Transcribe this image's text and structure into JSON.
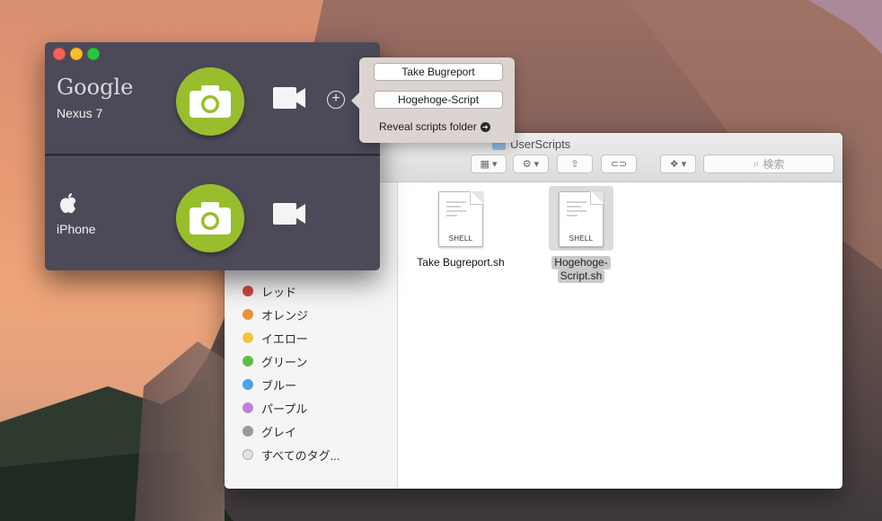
{
  "app": {
    "devices": [
      {
        "brand": "Google",
        "model": "Nexus 7"
      },
      {
        "brand": "apple-logo",
        "model": "iPhone"
      }
    ],
    "add_label": "+"
  },
  "popover": {
    "scripts": [
      "Take Bugreport",
      "Hogehoge-Script"
    ],
    "reveal_label": "Reveal scripts folder"
  },
  "finder": {
    "title": "UserScripts",
    "search_placeholder": "検索",
    "tags": [
      {
        "label": "レッド",
        "color": "#d24640"
      },
      {
        "label": "オレンジ",
        "color": "#e9923e"
      },
      {
        "label": "イエロー",
        "color": "#f1c63a"
      },
      {
        "label": "グリーン",
        "color": "#5dbf45"
      },
      {
        "label": "ブルー",
        "color": "#4aa3e3"
      },
      {
        "label": "パープル",
        "color": "#c27fd7"
      },
      {
        "label": "グレイ",
        "color": "#9a9a9a"
      },
      {
        "label": "すべてのタグ...",
        "color": "#e2e2e2"
      }
    ],
    "files": [
      {
        "name": "Take Bugreport.sh",
        "type": "SHELL"
      },
      {
        "name_line1": "Hogehoge-",
        "name_line2": "Script.sh",
        "type": "SHELL"
      }
    ]
  },
  "colors": {
    "app_bg": "#4c4a58",
    "camera_green": "#98be2e",
    "popover_bg": "#dcd4d1"
  }
}
